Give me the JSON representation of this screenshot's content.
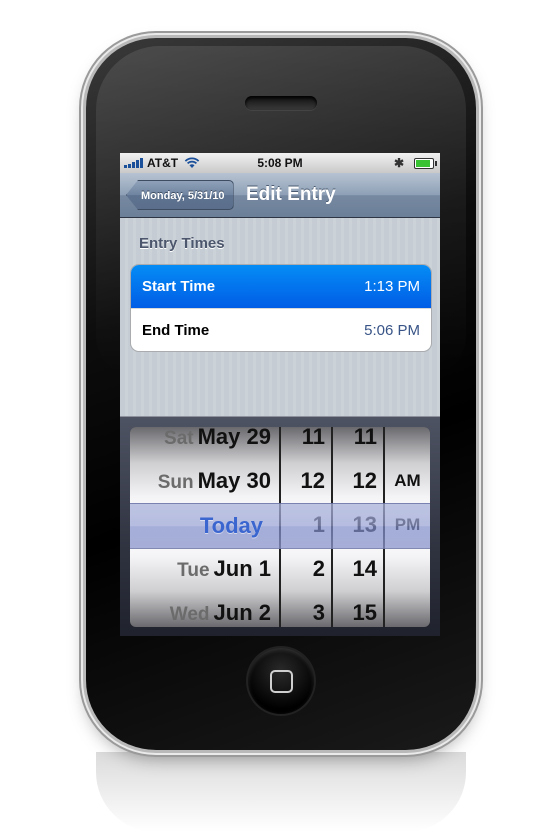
{
  "status_bar": {
    "carrier": "AT&T",
    "time": "5:08 PM"
  },
  "nav": {
    "back_label": "Monday, 5/31/10",
    "title": "Edit Entry"
  },
  "section": {
    "header": "Entry Times",
    "rows": [
      {
        "label": "Start Time",
        "value": "1:13 PM",
        "selected": true
      },
      {
        "label": "End Time",
        "value": "5:06 PM",
        "selected": false
      }
    ]
  },
  "picker": {
    "dates": [
      {
        "day": "Sat",
        "date": "May 29"
      },
      {
        "day": "Sun",
        "date": "May 30"
      },
      {
        "day": "",
        "date": ""
      },
      {
        "day": "Tue",
        "date": "Jun 1"
      },
      {
        "day": "Wed",
        "date": "Jun 2"
      }
    ],
    "selected_date": "Today",
    "hours": [
      "11",
      "12",
      "1",
      "2",
      "3"
    ],
    "minutes": [
      "11",
      "12",
      "13",
      "14",
      "15"
    ],
    "ampm": [
      "",
      "AM",
      "PM",
      "",
      ""
    ],
    "selection_color": "#3b66d0"
  },
  "colors": {
    "selected_row": "#015de6",
    "nav_bar": "#7689a1",
    "battery": "#39c332"
  }
}
